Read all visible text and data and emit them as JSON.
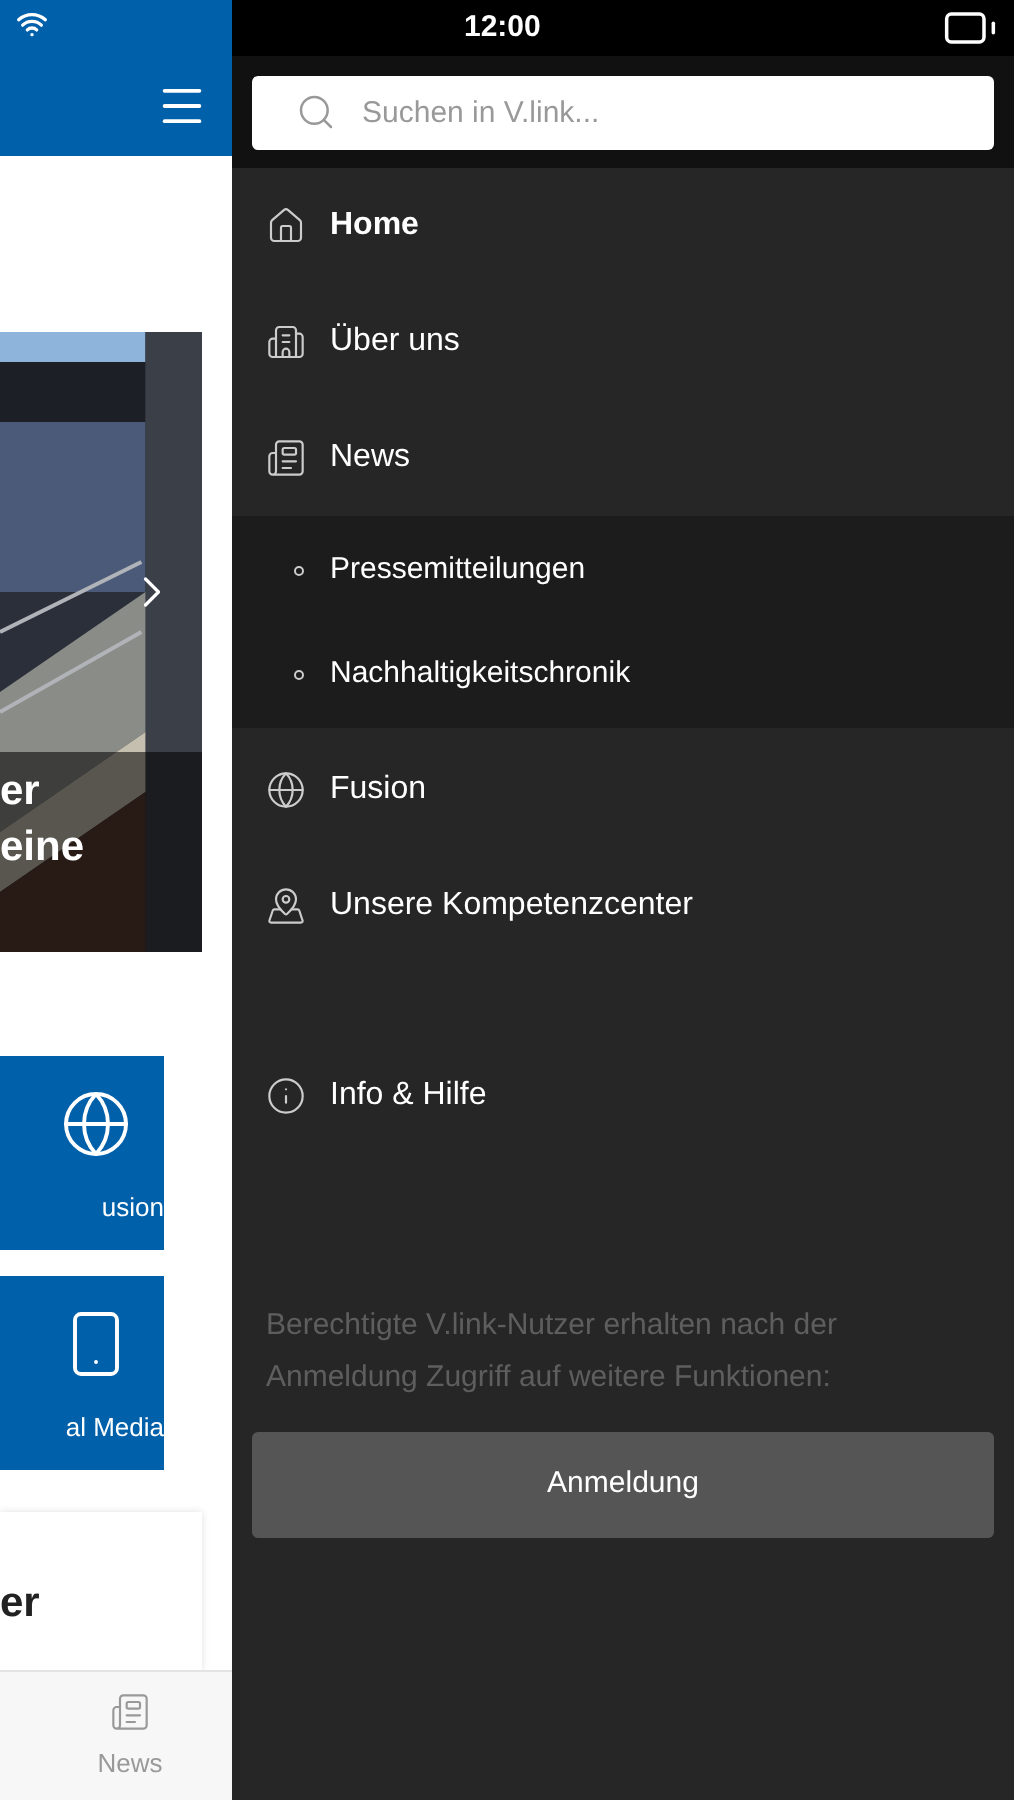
{
  "status_bar": {
    "time": "12:00"
  },
  "background_app": {
    "hero": {
      "title_lines": [
        "er",
        "eine"
      ]
    },
    "tiles": [
      {
        "kind": "globe",
        "label": "usion"
      },
      {
        "kind": "phone",
        "label": "al Media"
      }
    ],
    "card": {
      "title": "er"
    },
    "tab_bar": [
      {
        "label": "News",
        "selected": false
      }
    ]
  },
  "drawer": {
    "search": {
      "placeholder": "Suchen in V.link..."
    },
    "items": [
      {
        "kind": "home",
        "label": "Home",
        "selected": true
      },
      {
        "kind": "building",
        "label": "Über uns",
        "selected": false
      },
      {
        "kind": "news",
        "label": "News",
        "selected": false,
        "children": [
          {
            "label": "Pressemitteilungen"
          },
          {
            "label": "Nachhaltigkeitschronik"
          }
        ]
      },
      {
        "kind": "globe",
        "label": "Fusion",
        "selected": false
      },
      {
        "kind": "map",
        "label": "Unsere Kompetenzcenter",
        "selected": false
      },
      {
        "kind": "info",
        "label": "Info & Hilfe",
        "selected": false
      }
    ],
    "note": "Berechtigte V.link-Nutzer erhalten nach der Anmeldung Zugriff auf weitere Funktionen:",
    "login_button": "Anmeldung"
  }
}
